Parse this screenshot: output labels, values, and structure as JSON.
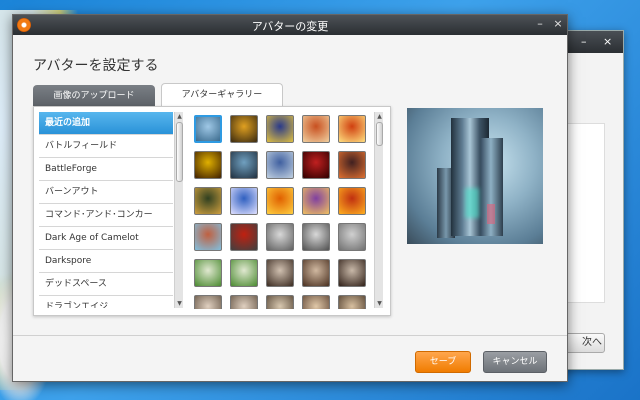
{
  "main_window": {
    "title": "アバターの変更",
    "heading": "アバターを設定する",
    "controls": {
      "minimize": "–",
      "close": "×"
    }
  },
  "tabs": [
    {
      "label": "画像のアップロード",
      "active": false
    },
    {
      "label": "アバターギャラリー",
      "active": true
    }
  ],
  "categories": [
    {
      "label": "最近の追加",
      "active": true
    },
    {
      "label": "バトルフィールド",
      "active": false
    },
    {
      "label": "BattleForge",
      "active": false
    },
    {
      "label": "バーンアウト",
      "active": false
    },
    {
      "label": "コマンド･アンド･コンカー",
      "active": false
    },
    {
      "label": "Dark Age of Camelot",
      "active": false
    },
    {
      "label": "Darkspore",
      "active": false
    },
    {
      "label": "デッドスペース",
      "active": false
    },
    {
      "label": "ドラゴンエイジ",
      "active": false
    }
  ],
  "gallery": {
    "columns": 5,
    "avatars": [
      {
        "colors": [
          "#9fc8e6",
          "#3b6b8e"
        ],
        "selected": true
      },
      {
        "colors": [
          "#e0a020",
          "#3a2a10"
        ]
      },
      {
        "colors": [
          "#2a3a8a",
          "#e0c040"
        ]
      },
      {
        "colors": [
          "#c85020",
          "#f0d0a0"
        ]
      },
      {
        "colors": [
          "#d04010",
          "#ffe080"
        ]
      },
      {
        "colors": [
          "#e0b000",
          "#402000"
        ]
      },
      {
        "colors": [
          "#70a0c0",
          "#203040"
        ]
      },
      {
        "colors": [
          "#4060a0",
          "#c0d0e0"
        ]
      },
      {
        "colors": [
          "#c02020",
          "#300000"
        ]
      },
      {
        "colors": [
          "#402020",
          "#e07030"
        ]
      },
      {
        "colors": [
          "#304020",
          "#d0a040"
        ]
      },
      {
        "colors": [
          "#3060c0",
          "#e0e0ff"
        ]
      },
      {
        "colors": [
          "#e06000",
          "#ffd040"
        ]
      },
      {
        "colors": [
          "#8040a0",
          "#f0c060"
        ]
      },
      {
        "colors": [
          "#c03010",
          "#ffb020"
        ]
      },
      {
        "colors": [
          "#c06040",
          "#80c0e0"
        ]
      },
      {
        "colors": [
          "#c02010",
          "#404040"
        ]
      },
      {
        "colors": [
          "#d8d8d8",
          "#606060"
        ]
      },
      {
        "colors": [
          "#d8d8d8",
          "#505050"
        ]
      },
      {
        "colors": [
          "#d0d0d0",
          "#707070"
        ]
      },
      {
        "colors": [
          "#e0e8d0",
          "#4a8a30"
        ]
      },
      {
        "colors": [
          "#e0e8d0",
          "#4a8a30"
        ]
      },
      {
        "colors": [
          "#d0c0b0",
          "#3a2a20"
        ]
      },
      {
        "colors": [
          "#d0b8a0",
          "#4a3020"
        ]
      },
      {
        "colors": [
          "#c8b8a8",
          "#302018"
        ]
      },
      {
        "colors": [
          "#e0d0c0",
          "#605040"
        ]
      },
      {
        "colors": [
          "#e0d0c0",
          "#605040"
        ]
      },
      {
        "colors": [
          "#d8c8b0",
          "#504030"
        ]
      },
      {
        "colors": [
          "#e0c8a8",
          "#5a4030"
        ]
      },
      {
        "colors": [
          "#d8c0a0",
          "#4a3828"
        ]
      }
    ]
  },
  "buttons": {
    "save": "セーブ",
    "cancel": "キャンセル"
  },
  "back_window": {
    "controls": {
      "minimize": "–",
      "close": "×"
    },
    "next_button": "次へ"
  },
  "colors": {
    "accent_blue": "#2a92d8",
    "save_orange": "#f07c00",
    "titlebar": "#2a2e32"
  }
}
